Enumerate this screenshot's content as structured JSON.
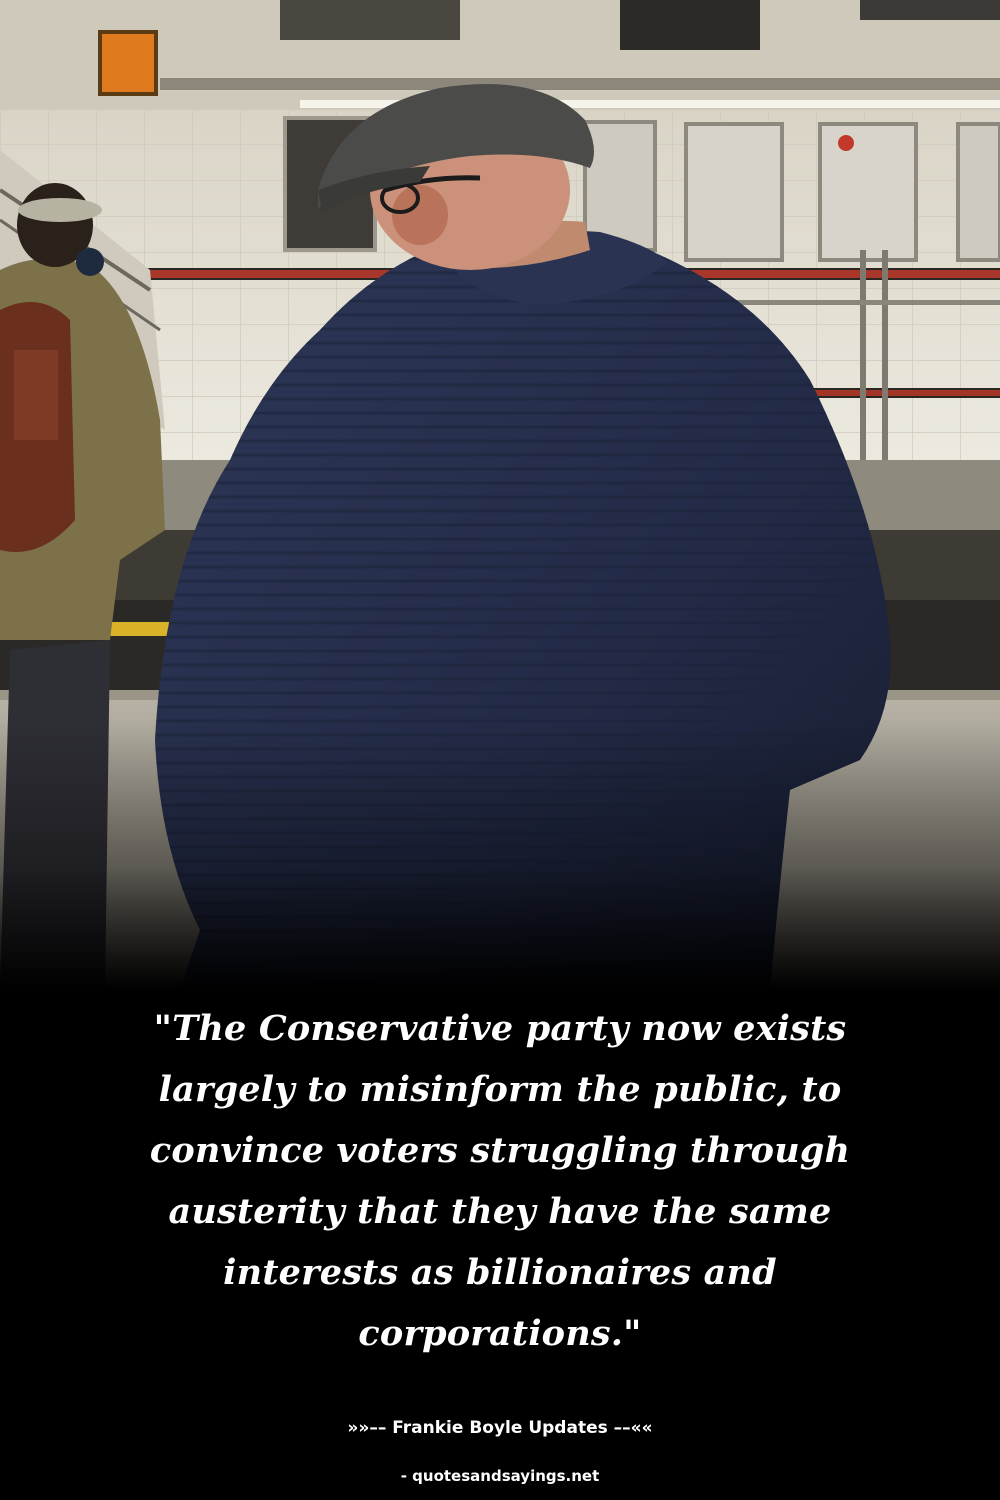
{
  "photo": {
    "scene": "subway-platform",
    "subjects": [
      "man-in-flat-cap",
      "person-with-headphones-and-backpack"
    ]
  },
  "quote": {
    "text": "\"The Conservative party now exists largely to misinform the public, to convince voters struggling through austerity that they have the same interests as billionaires and corporations.\""
  },
  "attribution": {
    "text": "»»–– Frankie Boyle Updates ––««"
  },
  "source": {
    "text": "- quotesandsayings.net"
  },
  "colors": {
    "background": "#000000",
    "text": "#ffffff",
    "sweater": "#232c4a",
    "tile_wall": "#e9e6dc",
    "stripe": "#c0392b"
  }
}
